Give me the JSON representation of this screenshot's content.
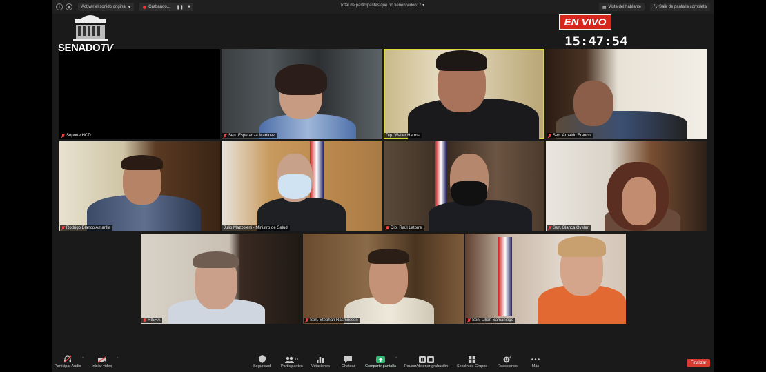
{
  "topbar": {
    "original_sound": "Activar el sonido original",
    "recording": "Grabando...",
    "participants_note": "Total de participantes que no tienen video: 7",
    "speaker_view": "Vista del hablante",
    "exit_fullscreen": "Salir de pantalla completa"
  },
  "overlay": {
    "logo_text": "SENADO",
    "logo_tv": "TV",
    "live": "EN VIVO",
    "clock": "15:47:54"
  },
  "participants": [
    {
      "name": "Soporte HCD"
    },
    {
      "name": "Sen. Esperanza Martinez"
    },
    {
      "name": "Dip. Walter Harms"
    },
    {
      "name": "Sen. Arnaldo Franco"
    },
    {
      "name": "Rodrigo Blanco Amarilla"
    },
    {
      "name": "Julio Mazzoleni - Ministro de Salud"
    },
    {
      "name": "Dip. Raúl Latorre"
    },
    {
      "name": "Sen. Blanca Ovelar"
    },
    {
      "name": "RIERA"
    },
    {
      "name": "Sen. Stephan Rasmussen"
    },
    {
      "name": "Sen. Lilian Samaniego"
    }
  ],
  "toolbar": {
    "audio": "Participar Audio",
    "video": "Iniciar video",
    "security": "Seguridad",
    "participants": "Participantes",
    "participants_count": "11",
    "polls": "Votaciones",
    "chat": "Chatear",
    "share": "Compartir pantalla",
    "record": "Pausar/detener grabación",
    "breakout": "Sesión de Grupos",
    "reactions": "Reacciones",
    "more": "Más",
    "end": "Finalizar"
  },
  "colors": {
    "live_red": "#d5271c",
    "share_green": "#2eb872",
    "end_red": "#d93a2e",
    "active_speaker": "#d8d83a"
  }
}
